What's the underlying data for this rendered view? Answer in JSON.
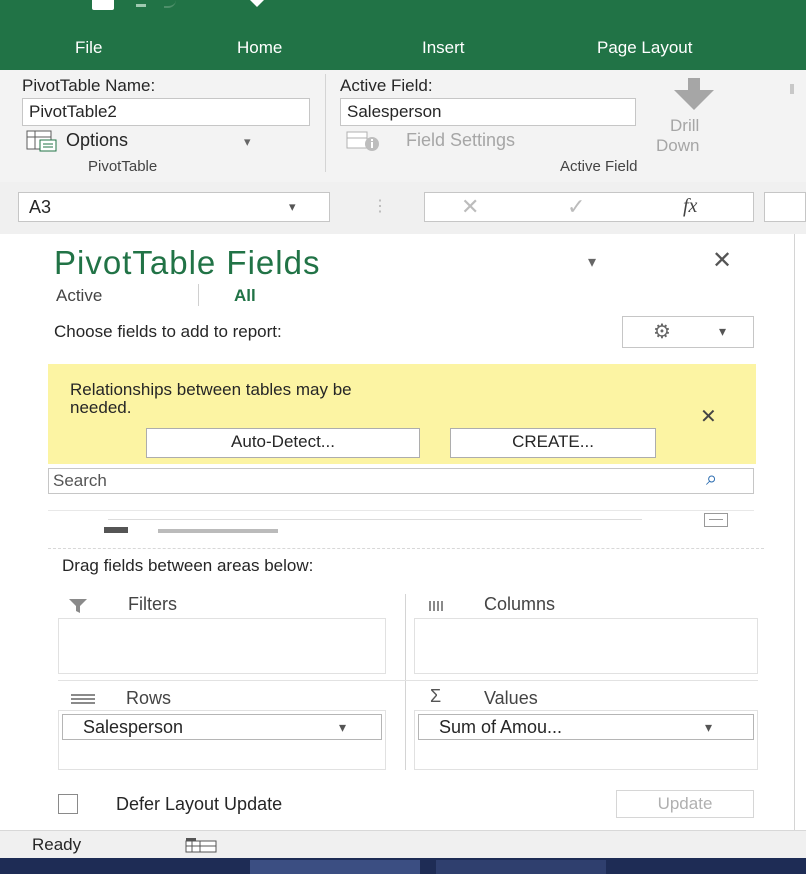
{
  "ribbon_tabs": [
    "File",
    "Home",
    "Insert",
    "Page Layout"
  ],
  "pivottable_group": {
    "name_label": "PivotTable Name:",
    "name_value": "PivotTable2",
    "options_label": "Options",
    "group_name": "PivotTable"
  },
  "active_field_group": {
    "label": "Active Field:",
    "value": "Salesperson",
    "field_settings_label": "Field Settings",
    "drill_down_line1": "Drill",
    "drill_down_line2": "Down",
    "group_name": "Active Field"
  },
  "formula_bar": {
    "name_box": "A3",
    "fx": "fx"
  },
  "pane": {
    "title": "PivotTable Fields",
    "tab_active": "Active",
    "tab_all": "All",
    "choose_fields": "Choose fields to add to report:",
    "relationship_msg_line1": "Relationships between tables may be",
    "relationship_msg_line2": "needed.",
    "auto_detect_label": "Auto-Detect...",
    "create_label": "CREATE...",
    "search_placeholder": "Search",
    "drag_fields": "Drag fields between areas below:",
    "filters_label": "Filters",
    "columns_label": "Columns",
    "rows_label": "Rows",
    "values_label": "Values",
    "rows_field": "Salesperson",
    "values_field": "Sum of Amou...",
    "defer_layout": "Defer Layout Update",
    "update_label": "Update"
  },
  "status": {
    "ready": "Ready"
  },
  "colors": {
    "excel_green": "#217346",
    "notice_yellow": "#fcf4a3"
  }
}
